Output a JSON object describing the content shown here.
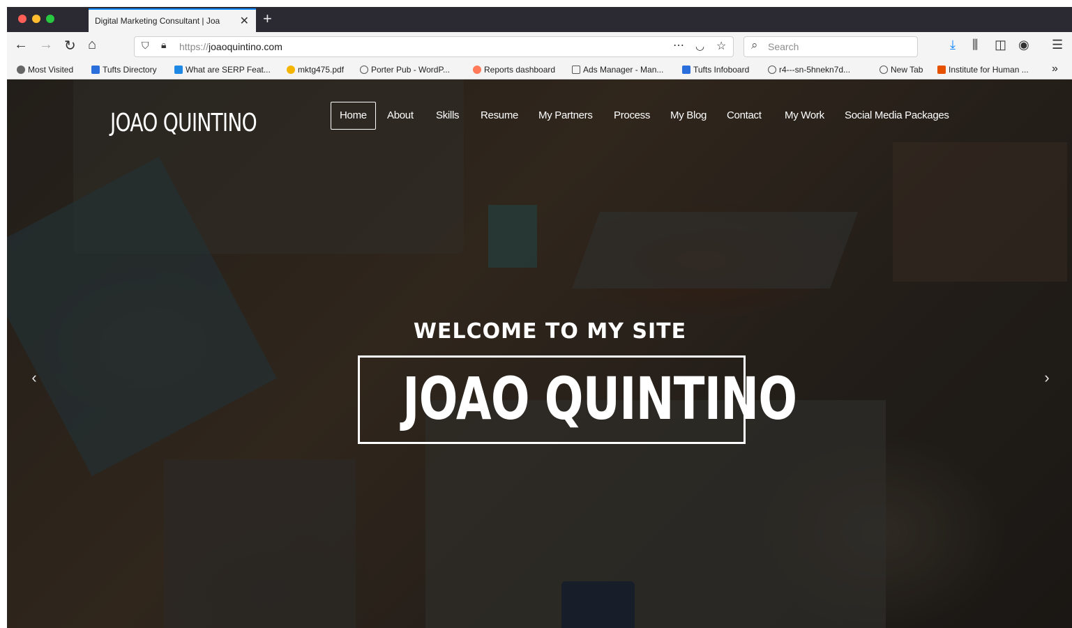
{
  "browser": {
    "tab_title": "Digital Marketing Consultant | Joa",
    "url_scheme": "https://",
    "url_host": "joaoquintino.com",
    "search_placeholder": "Search"
  },
  "bookmarks": [
    {
      "label": "Most Visited",
      "icon": "gear-icon",
      "color": "#555555"
    },
    {
      "label": "Tufts Directory",
      "icon": "tufts-icon",
      "color": "#2a6fdb"
    },
    {
      "label": "What are SERP Feat...",
      "icon": "site-icon",
      "color": "#1e88e5"
    },
    {
      "label": "mktg475.pdf",
      "icon": "pdf-icon",
      "color": "#f4b400"
    },
    {
      "label": "Porter Pub - WordP...",
      "icon": "globe-icon",
      "color": "#555555"
    },
    {
      "label": "Reports dashboard",
      "icon": "hubspot-icon",
      "color": "#ff7a59"
    },
    {
      "label": "Ads Manager - Man...",
      "icon": "ads-icon",
      "color": "#555555"
    },
    {
      "label": "Tufts Infoboard",
      "icon": "tufts-icon",
      "color": "#2a6fdb"
    },
    {
      "label": "r4---sn-5hnekn7d...",
      "icon": "globe-icon",
      "color": "#555555"
    },
    {
      "label": "New Tab",
      "icon": "globe-icon",
      "color": "#555555"
    },
    {
      "label": "Institute for Human ...",
      "icon": "ihmc-icon",
      "color": "#e65100"
    }
  ],
  "site": {
    "logo": "JOAO QUINTINO",
    "menu": [
      "Home",
      "About",
      "Skills",
      "Resume",
      "My Partners",
      "Process",
      "My Blog",
      "Contact",
      "My Work",
      "Social Media Packages"
    ],
    "hero_kicker": "WELCOME TO MY SITE",
    "hero_title": "JOAO QUINTINO"
  }
}
